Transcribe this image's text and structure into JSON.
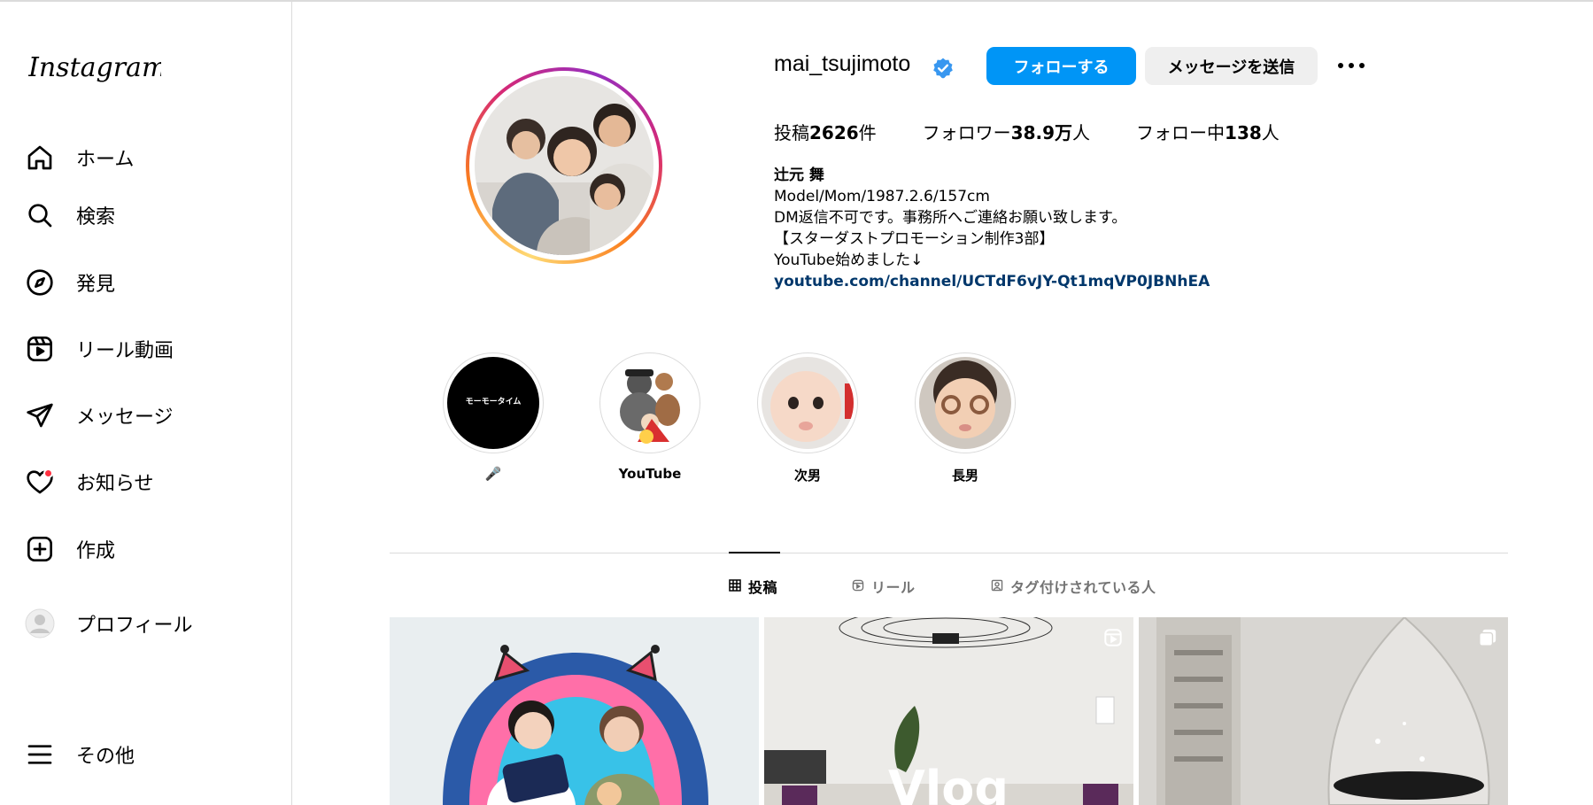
{
  "app": {
    "logo_text": "Instagram"
  },
  "sidebar": {
    "items": [
      {
        "label": "ホーム",
        "icon": "home-icon"
      },
      {
        "label": "検索",
        "icon": "search-icon"
      },
      {
        "label": "発見",
        "icon": "compass-icon"
      },
      {
        "label": "リール動画",
        "icon": "reels-icon"
      },
      {
        "label": "メッセージ",
        "icon": "send-icon"
      },
      {
        "label": "お知らせ",
        "icon": "heart-icon"
      },
      {
        "label": "作成",
        "icon": "plus-square-icon"
      },
      {
        "label": "プロフィール",
        "icon": "profile-avatar-icon"
      },
      {
        "label": "その他",
        "icon": "menu-icon"
      }
    ]
  },
  "profile": {
    "username": "mai_tsujimoto",
    "verified": true,
    "follow_label": "フォローする",
    "message_label": "メッセージを送信",
    "stats": {
      "posts_prefix": "投稿",
      "posts_value": "2626",
      "posts_suffix": "件",
      "followers_prefix": "フォロワー",
      "followers_value": "38.9万",
      "followers_suffix": "人",
      "following_prefix": "フォロー中",
      "following_value": "138",
      "following_suffix": "人"
    },
    "bio": {
      "name": "辻元 舞",
      "lines": [
        "Model/Mom/1987.2.6/157cm",
        "DM返信不可です。事務所へご連絡お願い致します。",
        "【スターダストプロモーション制作3部】",
        "YouTube始めました↓"
      ],
      "link": "youtube.com/channel/UCTdF6vJY-Qt1mqVP0JBNhEA"
    }
  },
  "highlights": [
    {
      "label": "🎤",
      "cover_text": "モーモータイム"
    },
    {
      "label": "YouTube"
    },
    {
      "label": "次男"
    },
    {
      "label": "長男"
    }
  ],
  "tabs": [
    {
      "label": "投稿",
      "icon": "grid-icon",
      "active": true
    },
    {
      "label": "リール",
      "icon": "reels-small-icon",
      "active": false
    },
    {
      "label": "タグ付けされている人",
      "icon": "tagged-icon",
      "active": false
    }
  ],
  "posts": [
    {
      "kind": "image"
    },
    {
      "kind": "reel",
      "overlay_text": "Vlog"
    },
    {
      "kind": "carousel"
    }
  ],
  "colors": {
    "accent": "#0095f6",
    "link": "#00376b",
    "notification": "#ff3040",
    "border": "#dbdbdb"
  }
}
